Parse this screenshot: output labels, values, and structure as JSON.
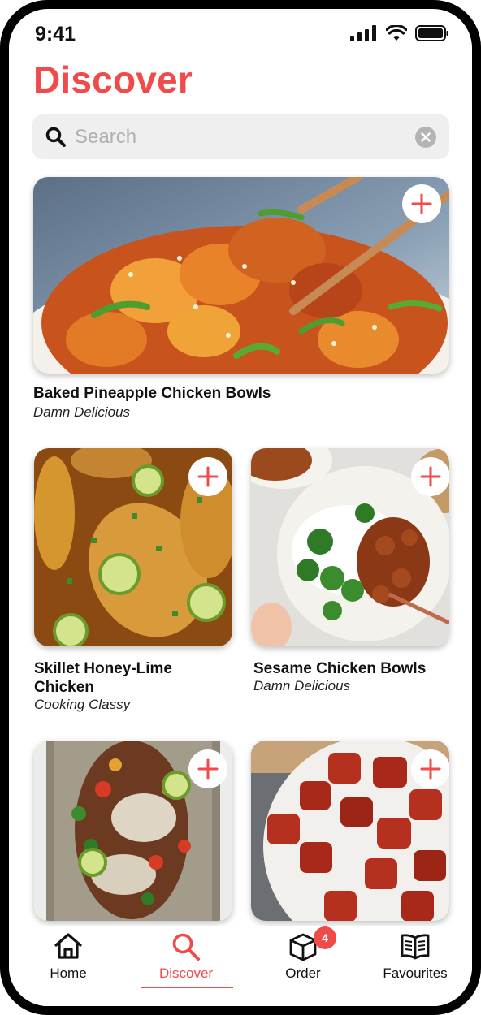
{
  "status_bar": {
    "time": "9:41"
  },
  "page": {
    "title": "Discover"
  },
  "search": {
    "placeholder": "Search",
    "value": ""
  },
  "recipes": [
    {
      "title": "Baked Pineapple Chicken Bowls",
      "source": "Damn Delicious"
    },
    {
      "title": "Skillet Honey-Lime Chicken",
      "source": "Cooking Classy"
    },
    {
      "title": "Sesame Chicken Bowls",
      "source": "Damn Delicious"
    },
    {
      "title": "",
      "source": ""
    },
    {
      "title": "",
      "source": ""
    }
  ],
  "nav": {
    "items": [
      {
        "label": "Home",
        "icon": "home-icon"
      },
      {
        "label": "Discover",
        "icon": "search-icon"
      },
      {
        "label": "Order",
        "icon": "box-icon",
        "badge": "4"
      },
      {
        "label": "Favourites",
        "icon": "book-icon"
      }
    ],
    "active": "Discover"
  },
  "colors": {
    "accent": "#f04a4a",
    "search_bg": "#efefef"
  }
}
